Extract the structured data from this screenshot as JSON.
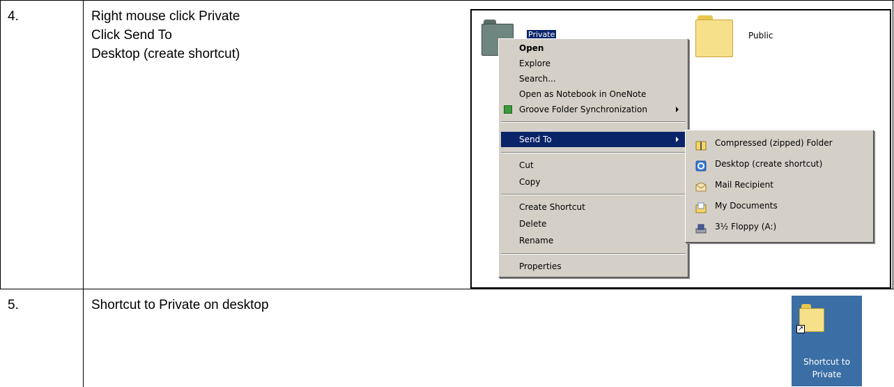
{
  "steps": [
    {
      "number": "4.",
      "lines": [
        "Right mouse click Private",
        "Click Send To",
        "Desktop (create shortcut)"
      ]
    },
    {
      "number": "5.",
      "lines": [
        "Shortcut to Private on desktop"
      ]
    }
  ],
  "screenshot": {
    "selected_folder_label": "Private",
    "public_folder_label": "Public",
    "context_menu": {
      "items": [
        {
          "label": "Open",
          "bold": true
        },
        {
          "label": "Explore"
        },
        {
          "label": "Search..."
        },
        {
          "label": "Open as Notebook in OneNote"
        },
        {
          "label": "Groove Folder Synchronization",
          "has_submenu": true,
          "icon": "groove-icon"
        },
        {
          "label": "Send To",
          "has_submenu": true,
          "highlighted": true
        },
        {
          "label": "Cut"
        },
        {
          "label": "Copy"
        },
        {
          "label": "Create Shortcut"
        },
        {
          "label": "Delete"
        },
        {
          "label": "Rename"
        },
        {
          "label": "Properties"
        }
      ],
      "highlight_color": "#0a246a",
      "background_color": "#d4d0c8"
    },
    "send_to_submenu": {
      "items": [
        {
          "label": "Compressed (zipped) Folder",
          "icon": "zip-folder-icon"
        },
        {
          "label": "Desktop (create shortcut)",
          "icon": "desktop-icon"
        },
        {
          "label": "Mail Recipient",
          "icon": "mail-icon"
        },
        {
          "label": "My Documents",
          "icon": "my-documents-icon"
        },
        {
          "label": "3½ Floppy (A:)",
          "icon": "floppy-drive-icon"
        }
      ]
    }
  },
  "desktop": {
    "background_color": "#3a6ea5",
    "shortcut_label_line1": "Shortcut to",
    "shortcut_label_line2": "Private"
  }
}
